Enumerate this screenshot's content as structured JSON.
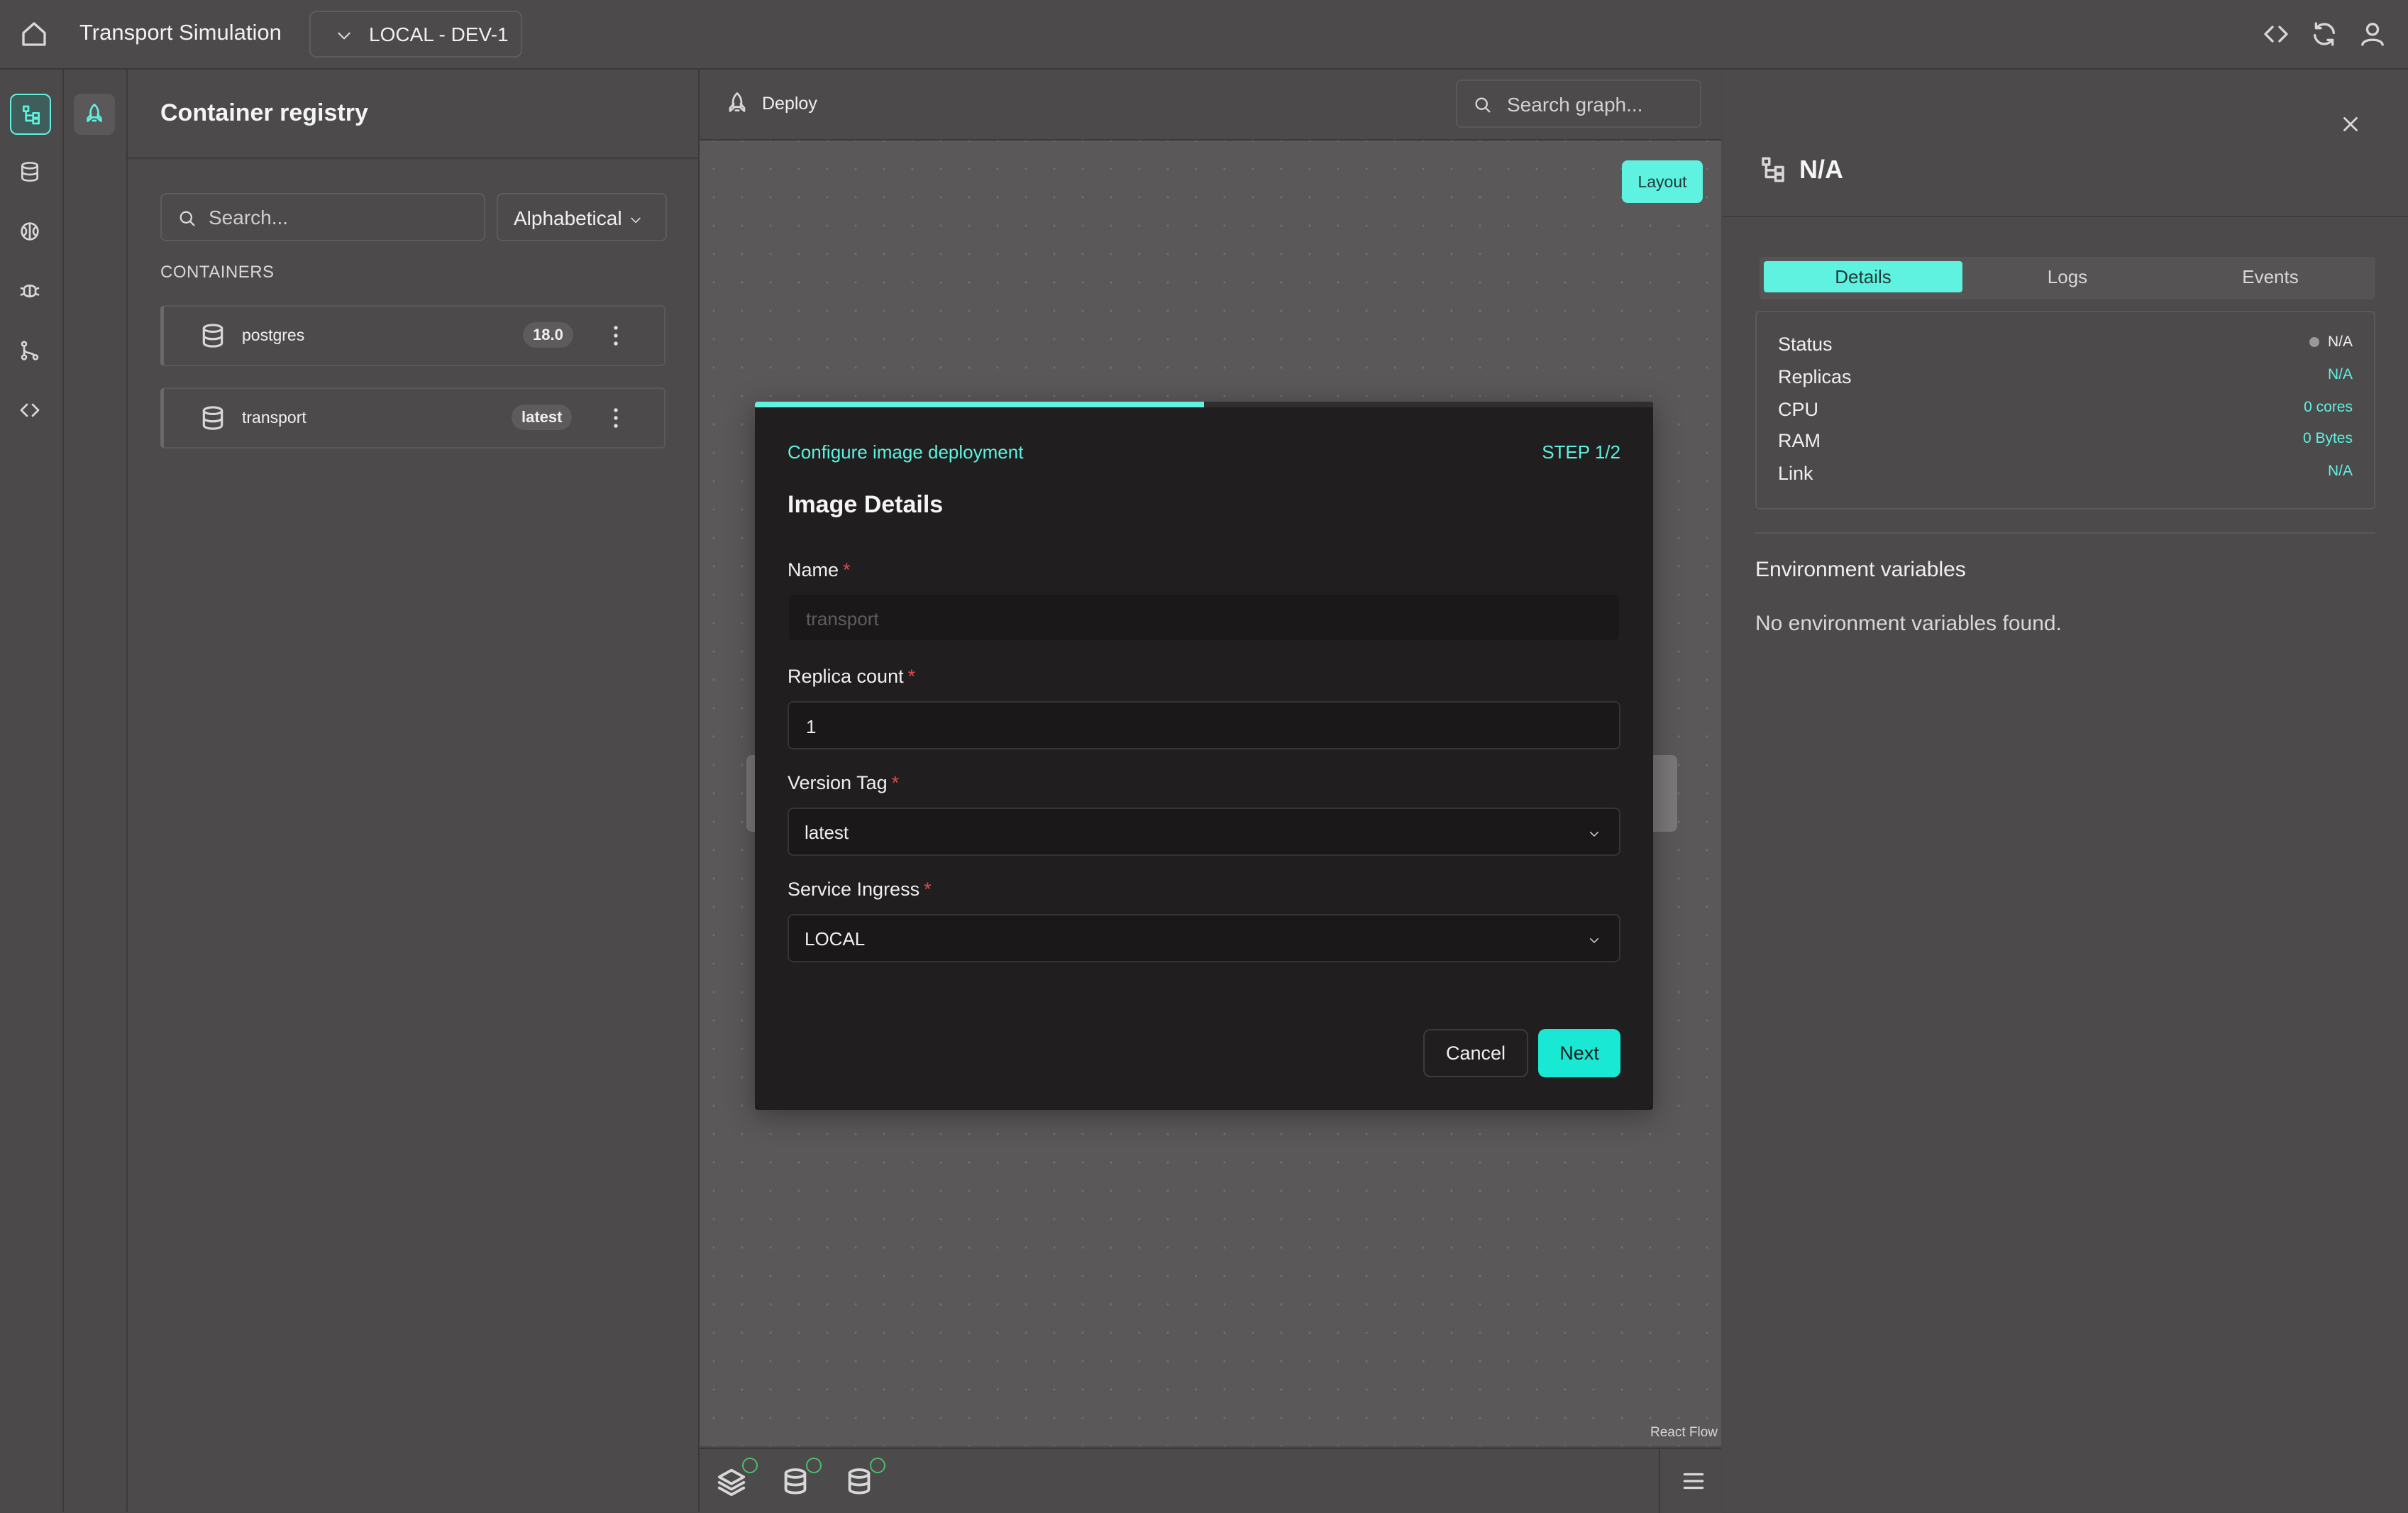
{
  "topbar": {
    "app_title": "Transport Simulation",
    "environment": "LOCAL - DEV-1",
    "icons": [
      "home-icon",
      "chevron-down-icon",
      "code-icon",
      "refresh-icon",
      "user-icon"
    ]
  },
  "rail": {
    "items": [
      "graph-icon",
      "database-icon",
      "brain-icon",
      "bug-icon",
      "branch-icon",
      "code-icon"
    ],
    "secondary": [
      "rocket-icon"
    ]
  },
  "registry": {
    "title": "Container registry",
    "search_placeholder": "Search...",
    "sort": "Alphabetical",
    "section_label": "CONTAINERS",
    "containers": [
      {
        "name": "postgres",
        "tag": "18.0"
      },
      {
        "name": "transport",
        "tag": "latest"
      }
    ]
  },
  "canvas": {
    "deploy_label": "Deploy",
    "search_placeholder": "Search graph...",
    "layout_button": "Layout",
    "attribution": "React Flow"
  },
  "modal": {
    "eyebrow": "Configure image deployment",
    "step": "STEP 1/2",
    "progress": 0.5,
    "title": "Image Details",
    "fields": {
      "name_label": "Name",
      "name_placeholder": "transport",
      "replica_label": "Replica count",
      "replica_value": "1",
      "version_label": "Version Tag",
      "version_value": "latest",
      "ingress_label": "Service Ingress",
      "ingress_value": "LOCAL"
    },
    "cancel_label": "Cancel",
    "next_label": "Next"
  },
  "details": {
    "title": "N/A",
    "tabs": [
      "Details",
      "Logs",
      "Events"
    ],
    "active_tab": "Details",
    "stats": [
      {
        "label": "Status",
        "value": "N/A"
      },
      {
        "label": "Replicas",
        "value": "N/A"
      },
      {
        "label": "CPU",
        "value": "0 cores"
      },
      {
        "label": "RAM",
        "value": "0 Bytes"
      },
      {
        "label": "Link",
        "value": "N/A"
      }
    ],
    "env_title": "Environment variables",
    "env_empty": "No environment variables found."
  },
  "colors": {
    "accent": "#5ff2e0",
    "next_button": "#19e8d4",
    "background": "#4c4a4b",
    "modal": "#201e1f",
    "required": "#e04b4b",
    "check": "#4dbd6a"
  }
}
